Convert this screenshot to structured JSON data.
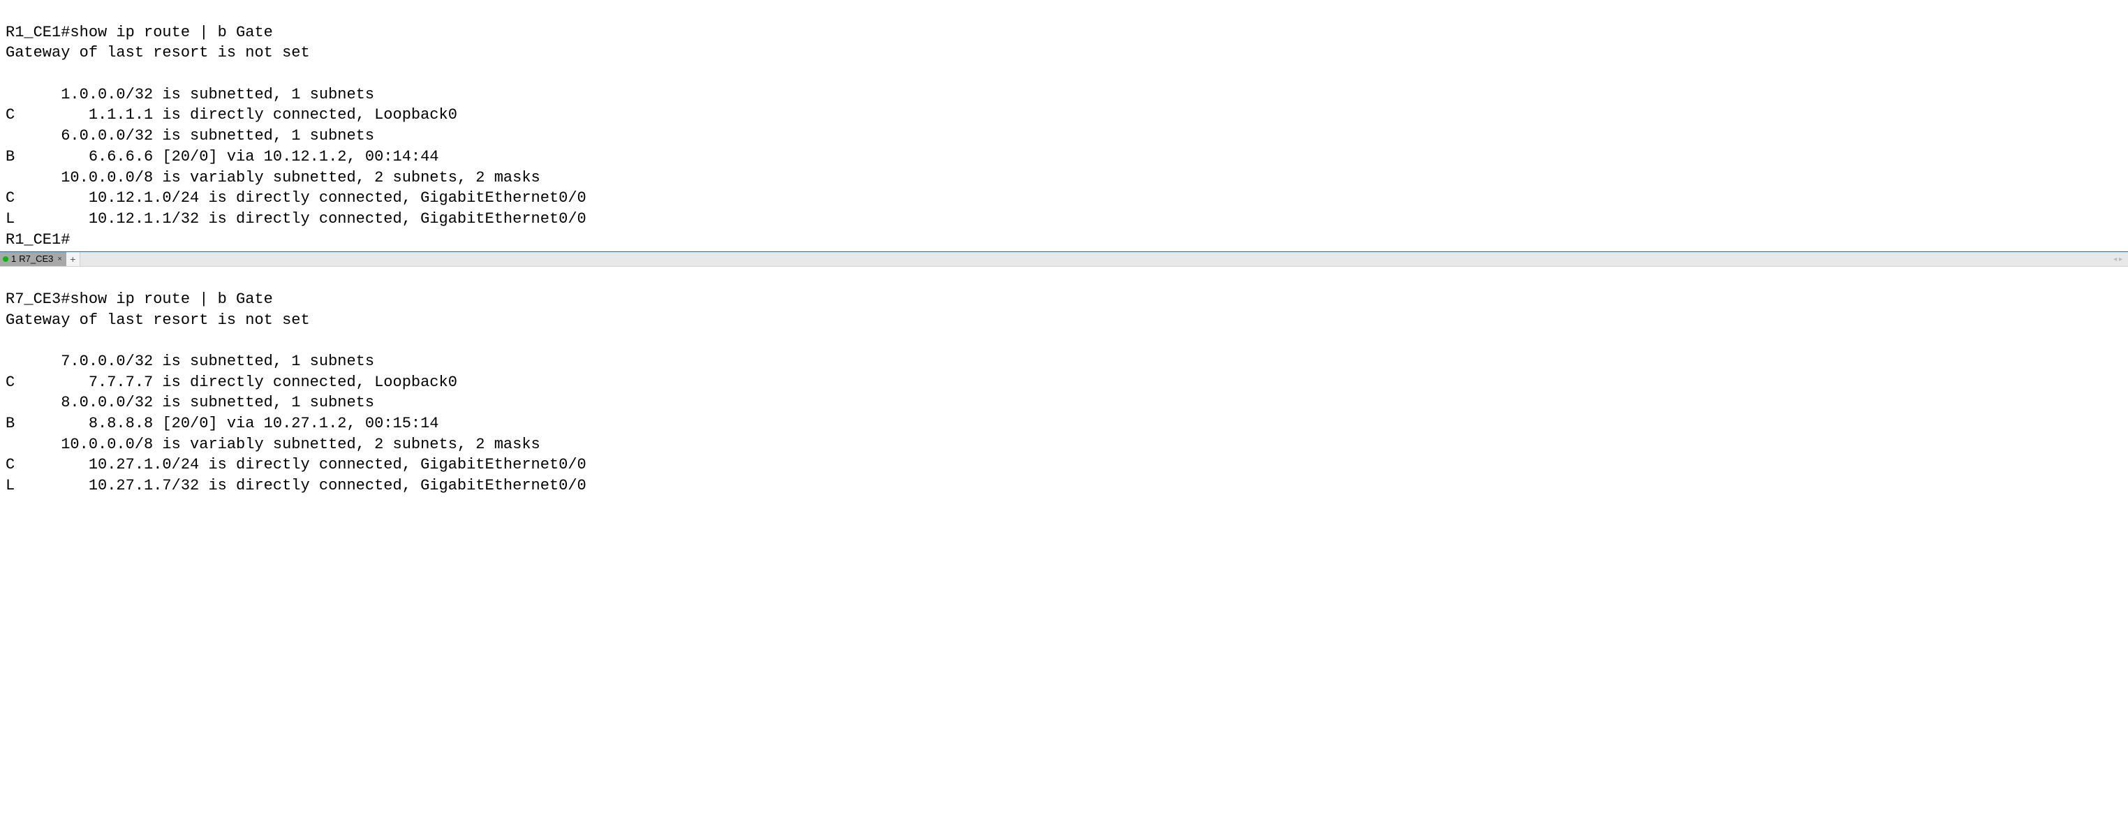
{
  "pane1": {
    "lines": [
      "R1_CE1#show ip route | b Gate",
      "Gateway of last resort is not set",
      "",
      "      1.0.0.0/32 is subnetted, 1 subnets",
      "C        1.1.1.1 is directly connected, Loopback0",
      "      6.0.0.0/32 is subnetted, 1 subnets",
      "B        6.6.6.6 [20/0] via 10.12.1.2, 00:14:44",
      "      10.0.0.0/8 is variably subnetted, 2 subnets, 2 masks",
      "C        10.12.1.0/24 is directly connected, GigabitEthernet0/0",
      "L        10.12.1.1/32 is directly connected, GigabitEthernet0/0",
      "R1_CE1#"
    ]
  },
  "tabbar": {
    "tab_number": "1",
    "tab_label": "R7_CE3",
    "add_label": "+",
    "arrows": "◂  ▸"
  },
  "pane2": {
    "lines": [
      "R7_CE3#show ip route | b Gate",
      "Gateway of last resort is not set",
      "",
      "      7.0.0.0/32 is subnetted, 1 subnets",
      "C        7.7.7.7 is directly connected, Loopback0",
      "      8.0.0.0/32 is subnetted, 1 subnets",
      "B        8.8.8.8 [20/0] via 10.27.1.2, 00:15:14",
      "      10.0.0.0/8 is variably subnetted, 2 subnets, 2 masks",
      "C        10.27.1.0/24 is directly connected, GigabitEthernet0/0",
      "L        10.27.1.7/32 is directly connected, GigabitEthernet0/0"
    ]
  }
}
